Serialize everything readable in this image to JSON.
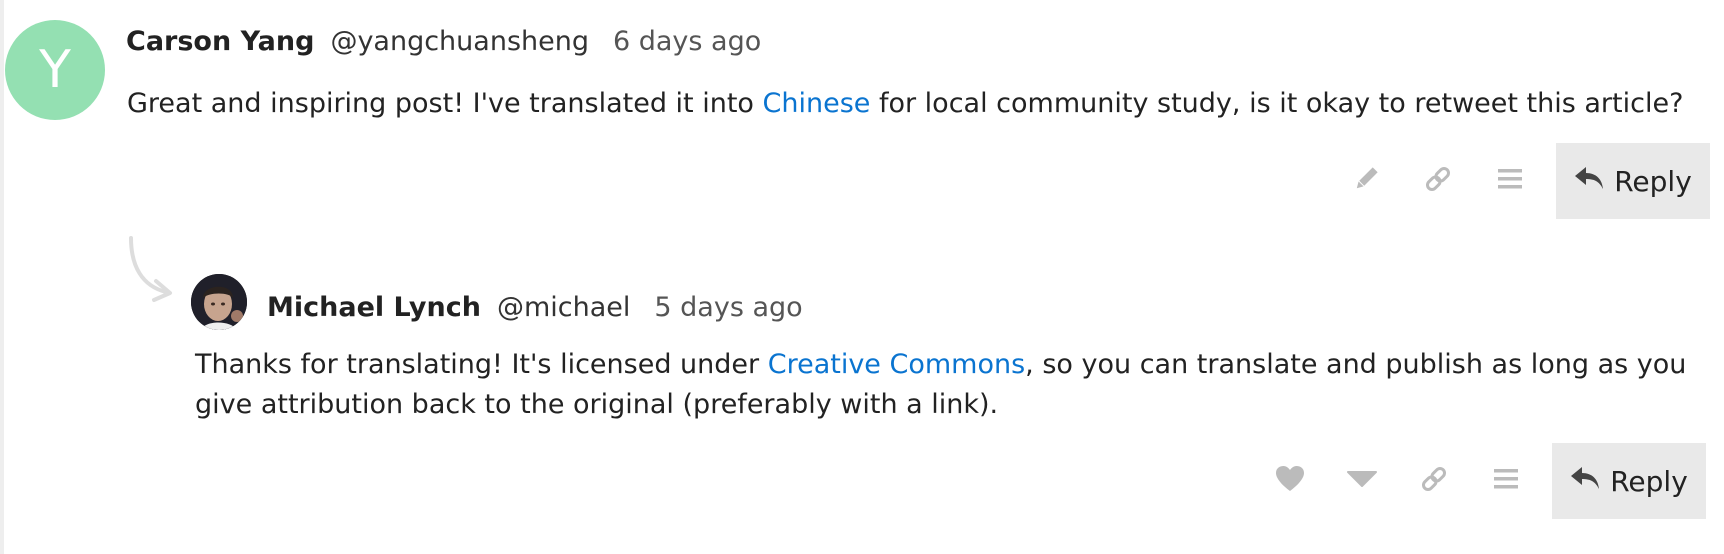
{
  "post1": {
    "avatar_letter": "Y",
    "avatar_color": "#94e0b2",
    "author_name": "Carson Yang",
    "handle": "@yangchuansheng",
    "date": "6 days ago",
    "text_before_link": "Great and inspiring post! I've translated it into ",
    "link_text": "Chinese",
    "text_after_link": " for local community study, is it okay to retweet this article?",
    "actions": {
      "edit_icon": "pencil-icon",
      "link_icon": "link-icon",
      "more_icon": "menu-icon",
      "reply_label": "Reply"
    }
  },
  "post2": {
    "author_name": "Michael Lynch",
    "handle": "@michael",
    "date": "5 days ago",
    "text_before_link": "Thanks for translating! It's licensed under ",
    "link_text": "Creative Commons",
    "text_after_link": ", so you can translate and publish as long as you give attribution back to the original (preferably with a link).",
    "actions": {
      "like_icon": "heart-icon",
      "downvote_icon": "downvote-icon",
      "link_icon": "link-icon",
      "more_icon": "menu-icon",
      "reply_label": "Reply"
    }
  },
  "colors": {
    "link": "#0a74d0",
    "reply_button_bg": "#e9e9e9",
    "icon_gray": "#bbbbbb"
  }
}
